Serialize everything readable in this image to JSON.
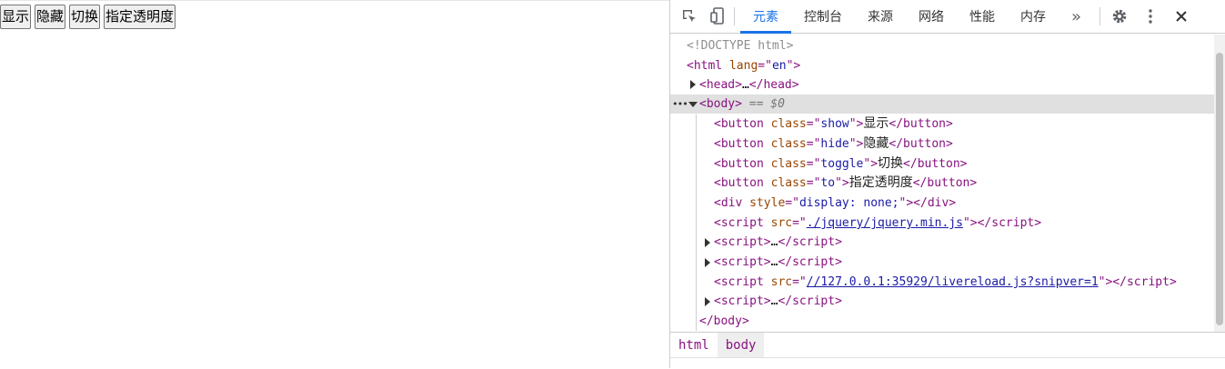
{
  "page": {
    "buttons": [
      "显示",
      "隐藏",
      "切换",
      "指定透明度"
    ]
  },
  "devtools": {
    "tabs": [
      {
        "label": "元素",
        "active": true
      },
      {
        "label": "控制台",
        "active": false
      },
      {
        "label": "来源",
        "active": false
      },
      {
        "label": "网络",
        "active": false
      },
      {
        "label": "性能",
        "active": false
      },
      {
        "label": "内存",
        "active": false
      }
    ],
    "more_tabs": "»",
    "dom": {
      "doctype": "<!DOCTYPE html>",
      "html_lang": "en",
      "head_collapsed": "…",
      "body_marker": "== $0",
      "buttons": [
        {
          "class": "show",
          "text": "显示"
        },
        {
          "class": "hide",
          "text": "隐藏"
        },
        {
          "class": "toggle",
          "text": "切换"
        },
        {
          "class": "to",
          "text": "指定透明度"
        }
      ],
      "div_style": "display: none;",
      "script_src_1": "./jquery/jquery.min.js",
      "script_src_2": "//127.0.0.1:35929/livereload.js?snipver=1",
      "ellipsis": "…"
    },
    "breadcrumbs": [
      "html",
      "body"
    ]
  }
}
